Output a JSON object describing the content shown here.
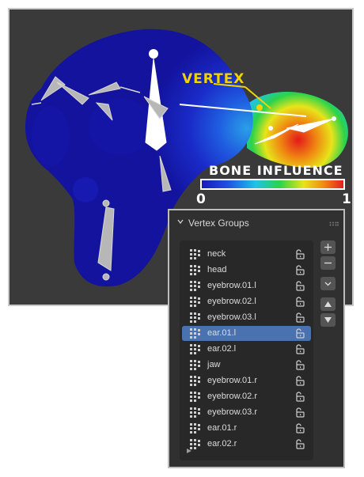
{
  "viewport": {
    "vertex_label": "VERTEX",
    "influence_title": "BONE INFLUENCE",
    "scale_min": "0",
    "scale_max": "1"
  },
  "panel": {
    "title": "Vertex Groups",
    "groups": [
      {
        "name": "neck",
        "selected": false
      },
      {
        "name": "head",
        "selected": false
      },
      {
        "name": "eyebrow.01.l",
        "selected": false
      },
      {
        "name": "eyebrow.02.l",
        "selected": false
      },
      {
        "name": "eyebrow.03.l",
        "selected": false
      },
      {
        "name": "ear.01.l",
        "selected": true
      },
      {
        "name": "ear.02.l",
        "selected": false
      },
      {
        "name": "jaw",
        "selected": false
      },
      {
        "name": "eyebrow.01.r",
        "selected": false
      },
      {
        "name": "eyebrow.02.r",
        "selected": false
      },
      {
        "name": "eyebrow.03.r",
        "selected": false
      },
      {
        "name": "ear.01.r",
        "selected": false
      },
      {
        "name": "ear.02.r",
        "selected": false
      }
    ],
    "side_buttons": [
      "add-icon",
      "remove-icon",
      "menu-icon",
      "move-up-icon",
      "move-down-icon"
    ]
  },
  "colors": {
    "vertex_accent": "#f2d300",
    "selection": "#4a72b0",
    "panel_bg": "#303030",
    "viewport_bg": "#3a3a3a"
  }
}
